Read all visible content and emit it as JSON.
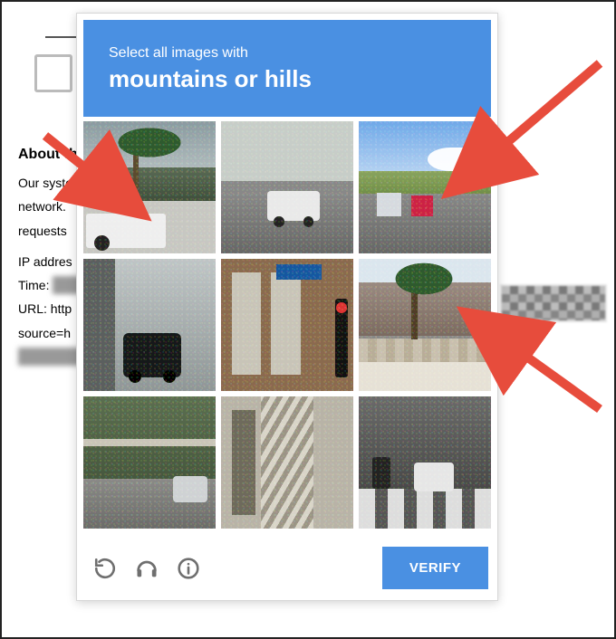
{
  "captcha": {
    "instruction": "Select all images with",
    "target": "mountains or hills",
    "verify_label": "VERIFY",
    "icons": {
      "reload": "reload-icon",
      "audio": "audio-icon",
      "info": "info-icon"
    },
    "tiles": [
      {
        "desc": "palm tree in front of cloudy mountains, white truck foreground"
      },
      {
        "desc": "white car on highway, overcast"
      },
      {
        "desc": "highway with trucks, green hills and clouds behind"
      },
      {
        "desc": "gas station forecourt with dark SUV"
      },
      {
        "desc": "brick building corner with street sign and traffic light"
      },
      {
        "desc": "palm tree with rocky mountains behind, awning below"
      },
      {
        "desc": "curved street with greenery and parked car"
      },
      {
        "desc": "fire escape on building facade"
      },
      {
        "desc": "cars and motorcycles at crosswalk intersection"
      }
    ]
  },
  "background": {
    "about_heading": "About th",
    "body_line1": "Our syste",
    "body_line2": "network.",
    "body_line3": "requests",
    "ip_label": "IP addres",
    "time_label": "Time:",
    "url_label": "URL: http",
    "source_label": "source=h"
  }
}
